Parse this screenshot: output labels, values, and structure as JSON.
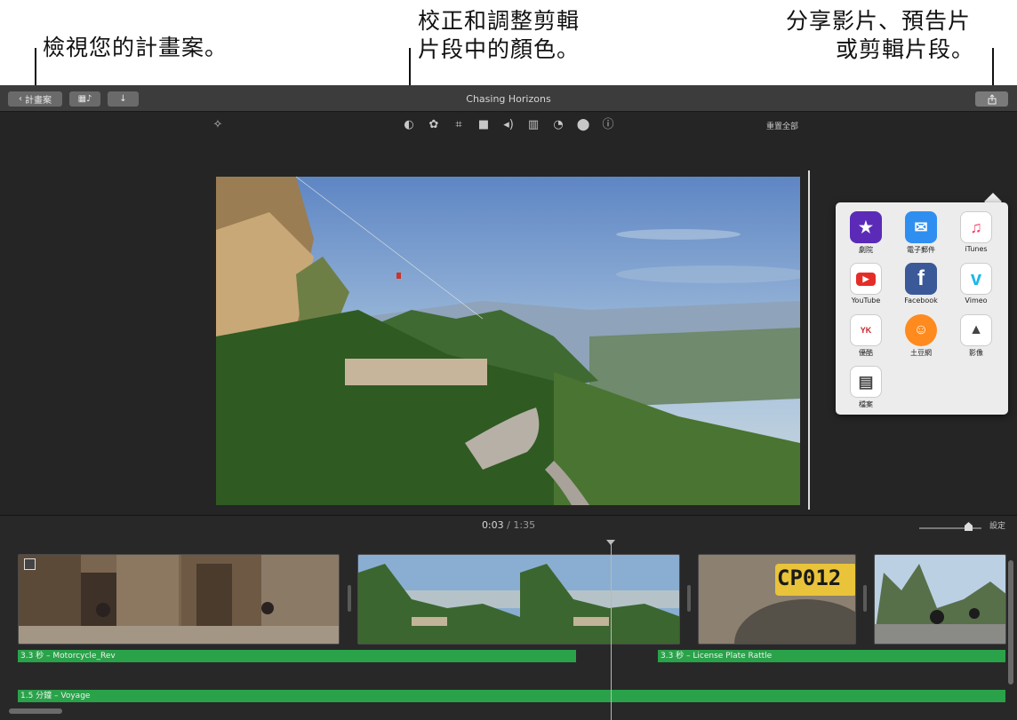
{
  "callouts": {
    "projects": "檢視您的計畫案。",
    "color_line1": "校正和調整剪輯",
    "color_line2": "片段中的顏色。",
    "share_line1": "分享影片、預告片",
    "share_line2": "或剪輯片段。"
  },
  "toolbar": {
    "back_label": "計畫案",
    "title": "Chasing Horizons"
  },
  "adjust_bar": {
    "reset_all": "重置全部",
    "icons": [
      "magic-wand-icon",
      "color-balance-icon",
      "color-correction-icon",
      "crop-icon",
      "stabilization-icon",
      "volume-icon",
      "equalizer-icon",
      "speed-icon",
      "filter-icon",
      "info-icon"
    ]
  },
  "share_menu": {
    "items": [
      {
        "label": "劇院",
        "icon": "theater-icon",
        "color": "#5b2bb8"
      },
      {
        "label": "電子郵件",
        "icon": "mail-icon",
        "color": "#2f8ff0"
      },
      {
        "label": "iTunes",
        "icon": "itunes-icon",
        "color": "#ffffff"
      },
      {
        "label": "YouTube",
        "icon": "youtube-icon",
        "color": "#ffffff"
      },
      {
        "label": "Facebook",
        "icon": "facebook-icon",
        "color": "#3b5998"
      },
      {
        "label": "Vimeo",
        "icon": "vimeo-icon",
        "color": "#ffffff"
      },
      {
        "label": "優酷",
        "icon": "youku-icon",
        "color": "#ffffff"
      },
      {
        "label": "土豆網",
        "icon": "tudou-icon",
        "color": "#ff8a1e"
      },
      {
        "label": "影像",
        "icon": "image-icon",
        "color": "#ffffff"
      },
      {
        "label": "檔案",
        "icon": "file-icon",
        "color": "#ffffff"
      }
    ]
  },
  "timeline": {
    "current_time": "0:03",
    "separator": "/",
    "total_time": "1:35",
    "settings_label": "設定",
    "audio_clips": [
      {
        "label": "3.3 秒 – Motorcycle_Rev"
      },
      {
        "label": "3.3 秒 – License Plate Rattle"
      },
      {
        "label": "1.5 分鐘 – Voyage"
      }
    ],
    "plate_text": "CP012"
  },
  "colors": {
    "audio_green": "#2aa24a",
    "window_bg": "#232323"
  }
}
